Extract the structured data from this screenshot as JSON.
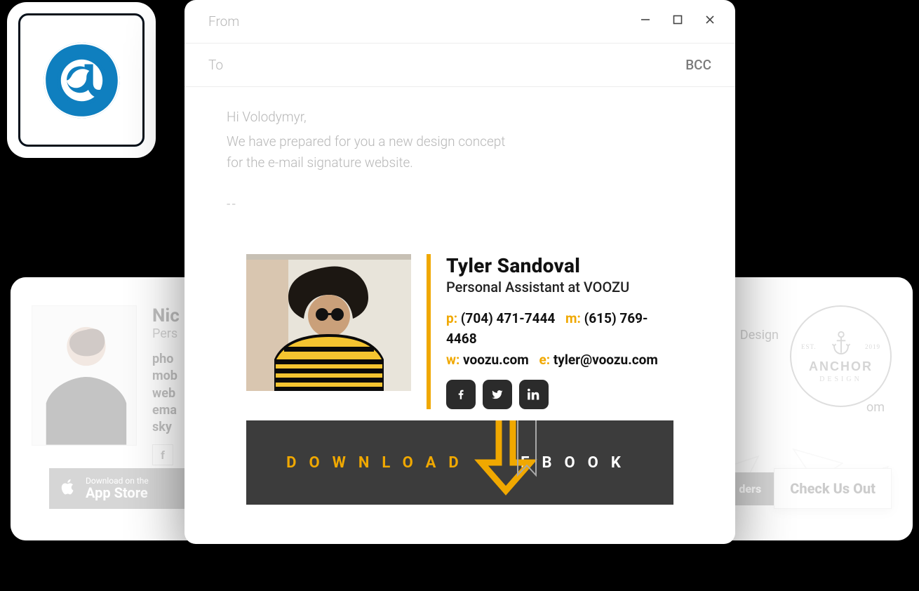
{
  "mailbird": {
    "alt": "Mailbird"
  },
  "compose": {
    "from_label": "From",
    "to_label": "To",
    "bcc_label": "BCC",
    "greeting": "Hi Volodymyr,",
    "message": "We have prepared for you a new design concept for the e-mail signature website.",
    "separator": "--"
  },
  "signature": {
    "name": "Tyler Sandoval",
    "role": "Personal Assistant at VOOZU",
    "phone_key": "p:",
    "phone": "(704) 471-7444",
    "mobile_key": "m:",
    "mobile": "(615) 769-4468",
    "web_key": "w:",
    "web": "voozu.com",
    "email_key": "e:",
    "email": "tyler@voozu.com",
    "banner_part1": "DOWNLOAD",
    "banner_part2": "EBOOK"
  },
  "left_card": {
    "name": "Nic",
    "role": "Pers",
    "l1": "pho",
    "l2": "mob",
    "l3": "web",
    "l4": "ema",
    "l5": "sky",
    "appstore_top": "Download on the",
    "appstore_bottom": "App Store"
  },
  "right_card": {
    "tag": "Design",
    "brand": "ANCHOR",
    "brand_sub": "DESIGN",
    "est": "EST.",
    "year": "2019",
    "om": "om",
    "pill1": "ders",
    "pill2": "Check Us Out"
  }
}
